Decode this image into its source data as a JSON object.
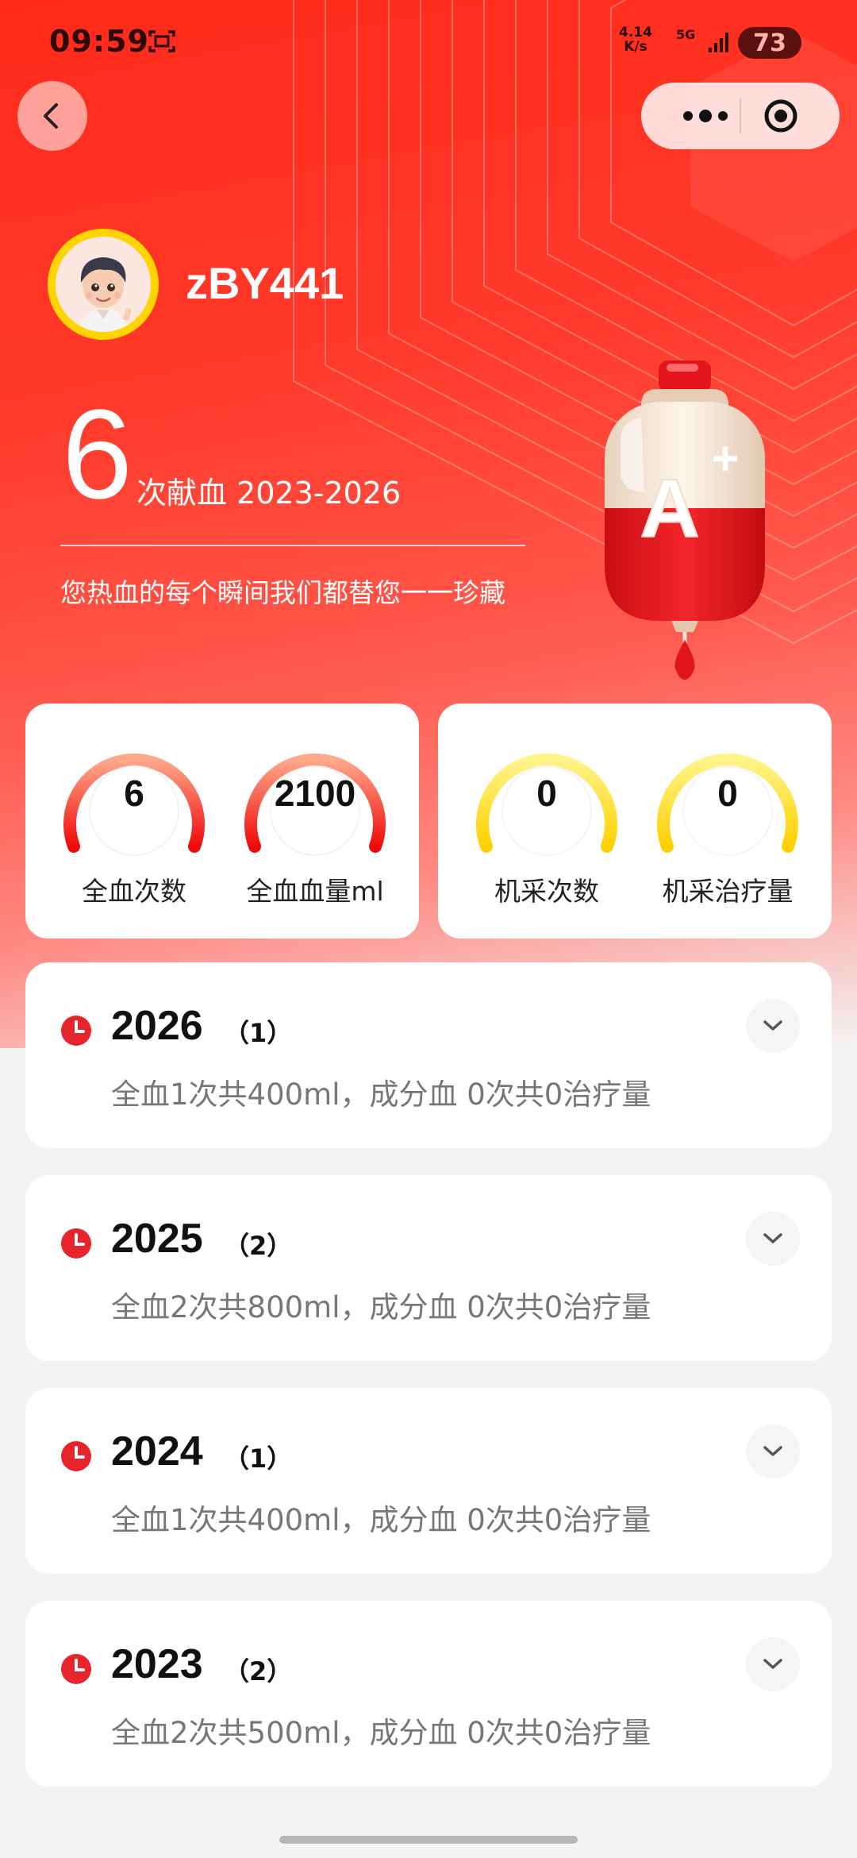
{
  "status_bar": {
    "time": "09:59",
    "net_speed_value": "4.14",
    "net_speed_unit": "K/s",
    "network": "5G",
    "battery": "73"
  },
  "profile": {
    "username": "zBY441"
  },
  "summary": {
    "donation_count": "6",
    "count_suffix": "次献血 2023-2026",
    "slogan": "您热血的每个瞬间我们都替您一一珍藏",
    "blood_type": "A+"
  },
  "stats": [
    {
      "value": "6",
      "label": "全血次数",
      "color": "red"
    },
    {
      "value": "2100",
      "label": "全血血量ml",
      "color": "red"
    },
    {
      "value": "0",
      "label": "机采次数",
      "color": "yellow"
    },
    {
      "value": "0",
      "label": "机采治疗量",
      "color": "yellow"
    }
  ],
  "years": [
    {
      "year": "2026",
      "count": "（1）",
      "detail": "全血1次共400ml，成分血 0次共0治疗量"
    },
    {
      "year": "2025",
      "count": "（2）",
      "detail": "全血2次共800ml，成分血 0次共0治疗量"
    },
    {
      "year": "2024",
      "count": "（1）",
      "detail": "全血1次共400ml，成分血 0次共0治疗量"
    },
    {
      "year": "2023",
      "count": "（2）",
      "detail": "全血2次共500ml，成分血 0次共0治疗量"
    }
  ],
  "colors": {
    "primary_red": "#ff2a1a",
    "gauge_red_start": "#ff9a7a",
    "gauge_red_end": "#f01010",
    "gauge_yellow_start": "#fff27a",
    "gauge_yellow_end": "#ffd400"
  }
}
